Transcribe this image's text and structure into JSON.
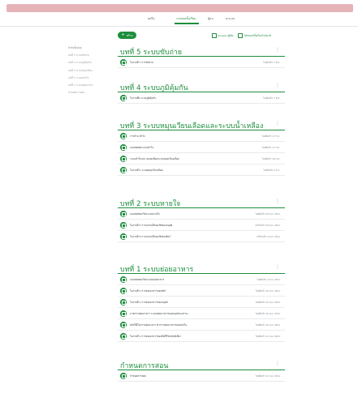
{
  "tabs": [
    {
      "label": "สตรีม"
    },
    {
      "label": "งานของชั้นเรียน"
    },
    {
      "label": "ผู้คน"
    },
    {
      "label": "คะแนน"
    }
  ],
  "toolbar": {
    "create_label": "สร้าง",
    "calendar_label": "Google ปฏิทิน",
    "drive_label": "โฟลเดอร์ชั้นเรียนในไดรฟ์"
  },
  "nav": [
    "หัวข้อทั้งหมด",
    "บทที่ 5 ระบบขับถ่าย",
    "บทที่ 4 ระบบภูมิคุ้มกัน",
    "บทที่ 3 ระบบหมุนเวียน...",
    "บทที่ 2 ระบบหายใจ",
    "บทที่ 1 ระบบย่อยอาหาร",
    "กำหนดการสอน"
  ],
  "topics": [
    {
      "title": "บทที่ 5 ระบบขับถ่าย",
      "items": [
        {
          "text": "ใบงานที่ 7 การขับถ่าย",
          "date": "โพสต์แล้ว 7 มี.ค."
        }
      ]
    },
    {
      "title": "บทที่ 4 ระบบภูมิคุ้มกัน",
      "items": [
        {
          "text": "ใบงานที่6 ระบบภูมิคุ้มกัน",
          "date": "โพสต์แล้ว 7 มี.ค."
        }
      ]
    },
    {
      "title": "บทที่ 3 ระบบหมุนเวียนเลือดและระบบน้ำเหลือง",
      "items": [
        {
          "text": "การบ้าน หัวใจ",
          "date": "โพสต์แล้ว 17 ก.พ."
        },
        {
          "text": "แบบทดสอบระบบหัวใจ",
          "date": "โพสต์แล้ว 17 ก.พ."
        },
        {
          "text": "ระบบหัวใจและ หลอดเลือดระบบหมุนเวียนเลือด",
          "date": "โพสต์แล้ว 16 ก.พ."
        },
        {
          "text": "ใบงานที่ 5 ระบบหมุนเวียนเลือด",
          "date": "โพสต์แล้ว 4 ก.พ."
        }
      ]
    },
    {
      "title": "บทที่ 2 ระบบหายใจ",
      "items": [
        {
          "text": "แบบทดสอบเรื่องระบบหายใจ",
          "date": "โพสต์แล้ว 30 ธ.ค. 2021"
        },
        {
          "text": "ใบงานที่ 3 การแลกเปลี่ยนแก๊สของมนุษย์",
          "date": "แก้ไขแล้ว 30 ธ.ค. 2021"
        },
        {
          "text": "ใบงานที่ 4 การแลกเปลี่ยนแก๊สของสัตว์",
          "date": "แก้ไขแล้ว 4 ธ.ค. 2021"
        }
      ]
    },
    {
      "title": "บทที่ 1 ระบบย่อยอาหาร",
      "items": [
        {
          "text": "แบบทดสอบเรื่องระบบย่อยอาหาร",
          "date": "โพสต์แล้ว 4 ธ.ค. 2021"
        },
        {
          "text": "ใบงานที่ 2 การย่อยอาหารของสัตว์",
          "date": "โพสต์แล้ว 16 พ.ย. 2021"
        },
        {
          "text": "ใบงานที่ 1 การย่อยอาหารของมนุษย์",
          "date": "โพสต์แล้ว 25 พ.ย. 2021"
        },
        {
          "text": "ภาพการย่อยอาหาร ระบบย่อยอาหารของมนุษย์และส่วน...",
          "date": "โพสต์แล้ว 16 พ.ย. 2021"
        },
        {
          "text": "คลิปวีดีโอการย่อยอาหาร ตัวการย่อยอาหารของคนเรื่อ...",
          "date": "โพสต์แล้ว 16 พ.ย. 2021"
        },
        {
          "text": "ใบงานที่ 1 การย่อยอาหารของสิ่งมีชีวิตเซลล์เดียว",
          "date": "โพสต์แล้ว 15 พ.ย. 2021"
        }
      ]
    },
    {
      "title": "กำหนดการสอน",
      "items": [
        {
          "text": "กำหนดการสอน",
          "date": "โพสต์แล้ว 11 พ.ย. 2021"
        }
      ]
    }
  ]
}
